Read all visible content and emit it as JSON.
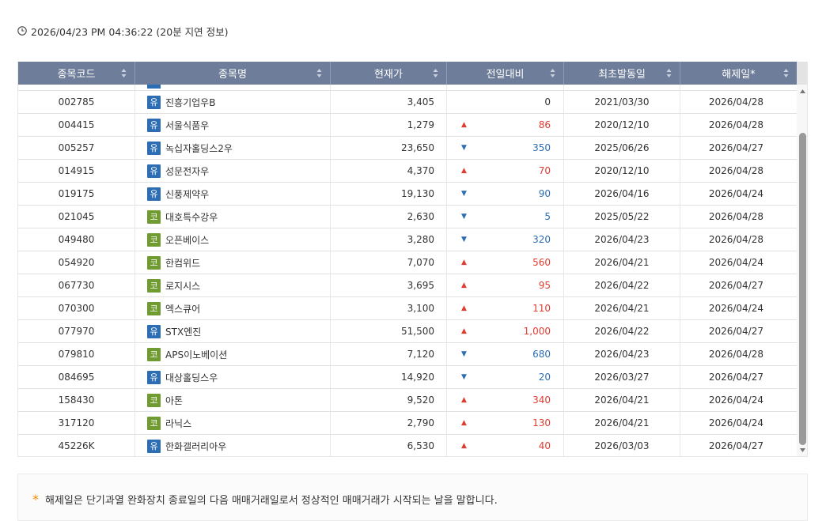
{
  "header": {
    "timestamp": "2026/04/23 PM 04:36:22 (20분 지연 정보)"
  },
  "table": {
    "columns": [
      "종목코드",
      "종목명",
      "현재가",
      "전일대비",
      "최초발동일",
      "해제일*"
    ],
    "rows": [
      {
        "code": "002785",
        "market": "유",
        "market_type": "kospi",
        "name": "진흥기업우B",
        "price": "3,405",
        "dir": "",
        "change": "0",
        "first_date": "2021/03/30",
        "release_date": "2026/04/28"
      },
      {
        "code": "004415",
        "market": "유",
        "market_type": "kospi",
        "name": "서울식품우",
        "price": "1,279",
        "dir": "▲",
        "change": "86",
        "first_date": "2020/12/10",
        "release_date": "2026/04/28"
      },
      {
        "code": "005257",
        "market": "유",
        "market_type": "kospi",
        "name": "녹십자홀딩스2우",
        "price": "23,650",
        "dir": "▼",
        "change": "350",
        "first_date": "2025/06/26",
        "release_date": "2026/04/27"
      },
      {
        "code": "014915",
        "market": "유",
        "market_type": "kospi",
        "name": "성문전자우",
        "price": "4,370",
        "dir": "▲",
        "change": "70",
        "first_date": "2020/12/10",
        "release_date": "2026/04/28"
      },
      {
        "code": "019175",
        "market": "유",
        "market_type": "kospi",
        "name": "신풍제약우",
        "price": "19,130",
        "dir": "▼",
        "change": "90",
        "first_date": "2026/04/16",
        "release_date": "2026/04/24"
      },
      {
        "code": "021045",
        "market": "코",
        "market_type": "kosdaq",
        "name": "대호특수강우",
        "price": "2,630",
        "dir": "▼",
        "change": "5",
        "first_date": "2025/05/22",
        "release_date": "2026/04/28"
      },
      {
        "code": "049480",
        "market": "코",
        "market_type": "kosdaq",
        "name": "오픈베이스",
        "price": "3,280",
        "dir": "▼",
        "change": "320",
        "first_date": "2026/04/23",
        "release_date": "2026/04/28"
      },
      {
        "code": "054920",
        "market": "코",
        "market_type": "kosdaq",
        "name": "한컴위드",
        "price": "7,070",
        "dir": "▲",
        "change": "560",
        "first_date": "2026/04/21",
        "release_date": "2026/04/24"
      },
      {
        "code": "067730",
        "market": "코",
        "market_type": "kosdaq",
        "name": "로지시스",
        "price": "3,695",
        "dir": "▲",
        "change": "95",
        "first_date": "2026/04/22",
        "release_date": "2026/04/27"
      },
      {
        "code": "070300",
        "market": "코",
        "market_type": "kosdaq",
        "name": "엑스큐어",
        "price": "3,100",
        "dir": "▲",
        "change": "110",
        "first_date": "2026/04/21",
        "release_date": "2026/04/24"
      },
      {
        "code": "077970",
        "market": "유",
        "market_type": "kospi",
        "name": "STX엔진",
        "price": "51,500",
        "dir": "▲",
        "change": "1,000",
        "first_date": "2026/04/22",
        "release_date": "2026/04/27"
      },
      {
        "code": "079810",
        "market": "코",
        "market_type": "kosdaq",
        "name": "APS이노베이션",
        "price": "7,120",
        "dir": "▼",
        "change": "680",
        "first_date": "2026/04/23",
        "release_date": "2026/04/28"
      },
      {
        "code": "084695",
        "market": "유",
        "market_type": "kospi",
        "name": "대상홀딩스우",
        "price": "14,920",
        "dir": "▼",
        "change": "20",
        "first_date": "2026/03/27",
        "release_date": "2026/04/27"
      },
      {
        "code": "158430",
        "market": "코",
        "market_type": "kosdaq",
        "name": "아톤",
        "price": "9,520",
        "dir": "▲",
        "change": "340",
        "first_date": "2026/04/21",
        "release_date": "2026/04/24"
      },
      {
        "code": "317120",
        "market": "코",
        "market_type": "kosdaq",
        "name": "라닉스",
        "price": "2,790",
        "dir": "▲",
        "change": "130",
        "first_date": "2026/04/21",
        "release_date": "2026/04/24"
      },
      {
        "code": "45226K",
        "market": "유",
        "market_type": "kospi",
        "name": "한화갤러리아우",
        "price": "6,530",
        "dir": "▲",
        "change": "40",
        "first_date": "2026/03/03",
        "release_date": "2026/04/27"
      }
    ]
  },
  "notice": {
    "text": "해제일은 단기과열 완화장치 종료일의 다음 매매거래일로서 정상적인 매매거래가 시작되는 날을 말합니다."
  },
  "colors": {
    "header_bg": "#6e7d99",
    "kospi_badge": "#2c6db3",
    "kosdaq_badge": "#6f9b31",
    "up": "#e03c31",
    "down": "#2c6db3",
    "notice_star": "#f08c00"
  },
  "icons": {
    "timestamp": "clock-icon",
    "sort": "sort-arrows-icon",
    "notice": "asterisk-icon"
  }
}
